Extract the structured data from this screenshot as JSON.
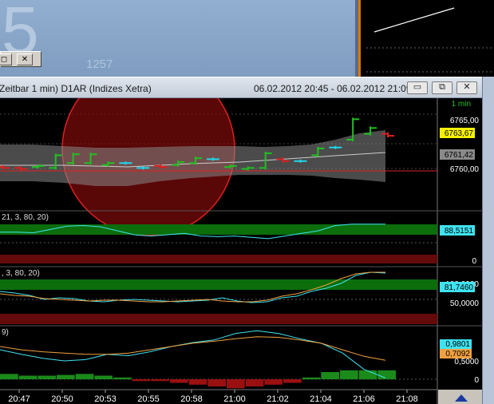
{
  "background": {
    "big_digit": "5",
    "small_number": "1257",
    "close_glyph": "✕",
    "restore_glyph": "◻"
  },
  "window": {
    "title": "Zeitbar 1 min)  D1AR (Indizes Xetra)",
    "range": "06.02.2012 20:45 - 06.02.2012 21:09",
    "buttons": {
      "minimize": "▭",
      "restore": "⧉",
      "close": "✕"
    }
  },
  "panels": {
    "price": {
      "timeframe": "1 min",
      "ticks": [
        "6765,00",
        "6760,00"
      ],
      "last_price": "6763,67",
      "ref_price": "6761,42"
    },
    "osc1": {
      "label": "21, 3, 80, 20)",
      "value": "88,5151",
      "ticks": [
        "0"
      ]
    },
    "osc2": {
      "label": ", 3, 80, 20)",
      "value": "81,7460",
      "value_hidden": "100,0000",
      "ticks": [
        "50,0000"
      ]
    },
    "osc3": {
      "label": "9)",
      "value_a": "0,9801",
      "value_b": "0,7092",
      "ticks": [
        "0,5000",
        "0"
      ]
    }
  },
  "time_axis": [
    "20:47",
    "20:50",
    "20:53",
    "20:55",
    "20:58",
    "21:00",
    "21:02",
    "21:04",
    "21:06",
    "21:08"
  ],
  "colors": {
    "up_bar": "#21c021",
    "down_bar": "#e02020",
    "flat_bar": "#22d4e8",
    "last_price_badge": "#f4f000",
    "osc_cyan": "#3fe3f0",
    "osc_orange": "#f0a040",
    "zone_green": "#0b6e0b",
    "zone_red": "#650a0a"
  },
  "icons": [
    "up-arrow-icon"
  ],
  "chart_data": [
    {
      "type": "bar",
      "title": "",
      "x": [
        "20:45",
        "20:46",
        "20:47",
        "20:48",
        "20:49",
        "20:50",
        "20:51",
        "20:52",
        "20:53",
        "20:54",
        "20:55",
        "20:56",
        "20:57",
        "20:58",
        "20:59",
        "21:00",
        "21:01",
        "21:02",
        "21:03",
        "21:04",
        "21:05",
        "21:06",
        "21:07"
      ],
      "open": [
        6760.4,
        6760.3,
        6760.4,
        6760.3,
        6760.8,
        6760.8,
        6760.6,
        6760.8,
        6760.3,
        6760.5,
        6760.6,
        6760.8,
        6761.2,
        6760.4,
        6760.2,
        6760.3,
        6761.2,
        6761.0,
        6761.6,
        6762.4,
        6763.2,
        6763.8,
        6763.8
      ],
      "close": [
        6760.3,
        6760.2,
        6760.5,
        6761.6,
        6761.7,
        6761.7,
        6760.8,
        6760.8,
        6760.3,
        6760.4,
        6760.9,
        6761.3,
        6761.2,
        6760.5,
        6760.3,
        6761.8,
        6761.0,
        6761.0,
        6762.3,
        6762.4,
        6765.3,
        6764.4,
        6763.6
      ],
      "series_lines": [
        "moving-average-gray-band"
      ]
    },
    {
      "type": "line",
      "series": [
        {
          "values": [
            76,
            76,
            75,
            80,
            85,
            86,
            84,
            78,
            72,
            70,
            72,
            74,
            70,
            69,
            70,
            68,
            66,
            70,
            74,
            78,
            86,
            88,
            88,
            88
          ]
        }
      ],
      "zones": {
        "upper": 80,
        "lower": 20
      }
    },
    {
      "type": "line",
      "series": [
        {
          "values": [
            58,
            56,
            53,
            48,
            50,
            49,
            46,
            45,
            47,
            48,
            47,
            46,
            45,
            46,
            47,
            50,
            46,
            44,
            45,
            50,
            52,
            58,
            62,
            68,
            78,
            82,
            81
          ]
        },
        {
          "values": [
            55,
            53,
            52,
            49,
            48,
            47,
            46,
            47,
            47,
            46,
            45,
            45,
            46,
            47,
            48,
            46,
            45,
            45,
            47,
            52,
            55,
            60,
            66,
            74,
            80,
            82,
            82
          ]
        }
      ],
      "ylim": [
        0,
        100
      ]
    },
    {
      "type": "line",
      "series": [
        {
          "values": [
            0.55,
            0.62,
            0.68,
            0.72,
            0.7,
            0.62,
            0.64,
            0.58,
            0.5,
            0.44,
            0.4,
            0.3,
            0.26,
            0.3,
            0.38,
            0.45,
            0.6,
            0.85,
            0.98
          ]
        },
        {
          "values": [
            0.5,
            0.55,
            0.58,
            0.6,
            0.62,
            0.62,
            0.6,
            0.55,
            0.5,
            0.45,
            0.42,
            0.38,
            0.35,
            0.36,
            0.4,
            0.45,
            0.55,
            0.65,
            0.71
          ]
        }
      ],
      "histogram": [
        0.15,
        0.1,
        0.1,
        0.12,
        0.15,
        0.1,
        0.05,
        -0.05,
        -0.05,
        -0.1,
        -0.15,
        -0.2,
        -0.25,
        -0.2,
        -0.15,
        -0.1,
        0.05,
        0.2,
        0.25,
        0.25,
        0.25
      ]
    }
  ]
}
